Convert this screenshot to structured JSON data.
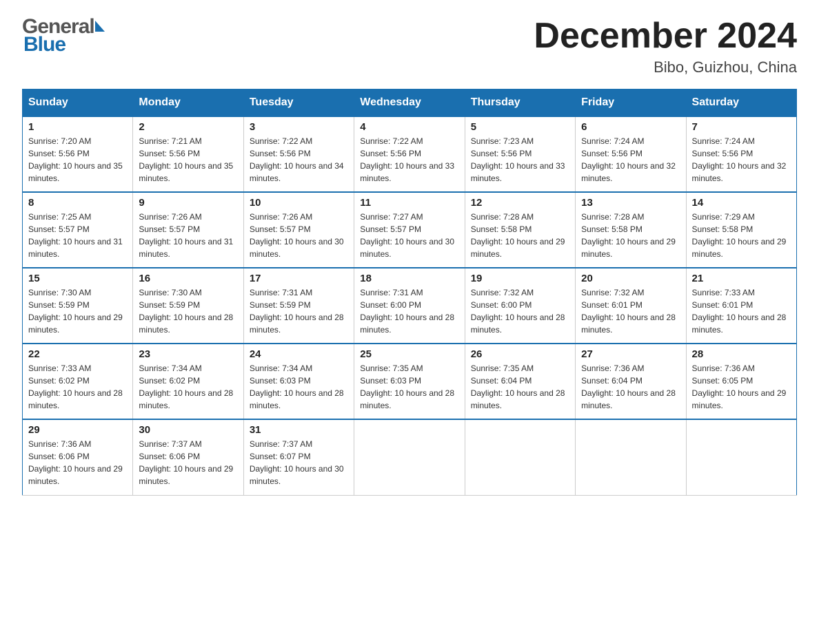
{
  "header": {
    "title": "December 2024",
    "subtitle": "Bibo, Guizhou, China"
  },
  "logo": {
    "general": "General",
    "blue": "Blue"
  },
  "days": [
    "Sunday",
    "Monday",
    "Tuesday",
    "Wednesday",
    "Thursday",
    "Friday",
    "Saturday"
  ],
  "weeks": [
    [
      {
        "day": "1",
        "sunrise": "7:20 AM",
        "sunset": "5:56 PM",
        "daylight": "10 hours and 35 minutes."
      },
      {
        "day": "2",
        "sunrise": "7:21 AM",
        "sunset": "5:56 PM",
        "daylight": "10 hours and 35 minutes."
      },
      {
        "day": "3",
        "sunrise": "7:22 AM",
        "sunset": "5:56 PM",
        "daylight": "10 hours and 34 minutes."
      },
      {
        "day": "4",
        "sunrise": "7:22 AM",
        "sunset": "5:56 PM",
        "daylight": "10 hours and 33 minutes."
      },
      {
        "day": "5",
        "sunrise": "7:23 AM",
        "sunset": "5:56 PM",
        "daylight": "10 hours and 33 minutes."
      },
      {
        "day": "6",
        "sunrise": "7:24 AM",
        "sunset": "5:56 PM",
        "daylight": "10 hours and 32 minutes."
      },
      {
        "day": "7",
        "sunrise": "7:24 AM",
        "sunset": "5:56 PM",
        "daylight": "10 hours and 32 minutes."
      }
    ],
    [
      {
        "day": "8",
        "sunrise": "7:25 AM",
        "sunset": "5:57 PM",
        "daylight": "10 hours and 31 minutes."
      },
      {
        "day": "9",
        "sunrise": "7:26 AM",
        "sunset": "5:57 PM",
        "daylight": "10 hours and 31 minutes."
      },
      {
        "day": "10",
        "sunrise": "7:26 AM",
        "sunset": "5:57 PM",
        "daylight": "10 hours and 30 minutes."
      },
      {
        "day": "11",
        "sunrise": "7:27 AM",
        "sunset": "5:57 PM",
        "daylight": "10 hours and 30 minutes."
      },
      {
        "day": "12",
        "sunrise": "7:28 AM",
        "sunset": "5:58 PM",
        "daylight": "10 hours and 29 minutes."
      },
      {
        "day": "13",
        "sunrise": "7:28 AM",
        "sunset": "5:58 PM",
        "daylight": "10 hours and 29 minutes."
      },
      {
        "day": "14",
        "sunrise": "7:29 AM",
        "sunset": "5:58 PM",
        "daylight": "10 hours and 29 minutes."
      }
    ],
    [
      {
        "day": "15",
        "sunrise": "7:30 AM",
        "sunset": "5:59 PM",
        "daylight": "10 hours and 29 minutes."
      },
      {
        "day": "16",
        "sunrise": "7:30 AM",
        "sunset": "5:59 PM",
        "daylight": "10 hours and 28 minutes."
      },
      {
        "day": "17",
        "sunrise": "7:31 AM",
        "sunset": "5:59 PM",
        "daylight": "10 hours and 28 minutes."
      },
      {
        "day": "18",
        "sunrise": "7:31 AM",
        "sunset": "6:00 PM",
        "daylight": "10 hours and 28 minutes."
      },
      {
        "day": "19",
        "sunrise": "7:32 AM",
        "sunset": "6:00 PM",
        "daylight": "10 hours and 28 minutes."
      },
      {
        "day": "20",
        "sunrise": "7:32 AM",
        "sunset": "6:01 PM",
        "daylight": "10 hours and 28 minutes."
      },
      {
        "day": "21",
        "sunrise": "7:33 AM",
        "sunset": "6:01 PM",
        "daylight": "10 hours and 28 minutes."
      }
    ],
    [
      {
        "day": "22",
        "sunrise": "7:33 AM",
        "sunset": "6:02 PM",
        "daylight": "10 hours and 28 minutes."
      },
      {
        "day": "23",
        "sunrise": "7:34 AM",
        "sunset": "6:02 PM",
        "daylight": "10 hours and 28 minutes."
      },
      {
        "day": "24",
        "sunrise": "7:34 AM",
        "sunset": "6:03 PM",
        "daylight": "10 hours and 28 minutes."
      },
      {
        "day": "25",
        "sunrise": "7:35 AM",
        "sunset": "6:03 PM",
        "daylight": "10 hours and 28 minutes."
      },
      {
        "day": "26",
        "sunrise": "7:35 AM",
        "sunset": "6:04 PM",
        "daylight": "10 hours and 28 minutes."
      },
      {
        "day": "27",
        "sunrise": "7:36 AM",
        "sunset": "6:04 PM",
        "daylight": "10 hours and 28 minutes."
      },
      {
        "day": "28",
        "sunrise": "7:36 AM",
        "sunset": "6:05 PM",
        "daylight": "10 hours and 29 minutes."
      }
    ],
    [
      {
        "day": "29",
        "sunrise": "7:36 AM",
        "sunset": "6:06 PM",
        "daylight": "10 hours and 29 minutes."
      },
      {
        "day": "30",
        "sunrise": "7:37 AM",
        "sunset": "6:06 PM",
        "daylight": "10 hours and 29 minutes."
      },
      {
        "day": "31",
        "sunrise": "7:37 AM",
        "sunset": "6:07 PM",
        "daylight": "10 hours and 30 minutes."
      },
      null,
      null,
      null,
      null
    ]
  ]
}
